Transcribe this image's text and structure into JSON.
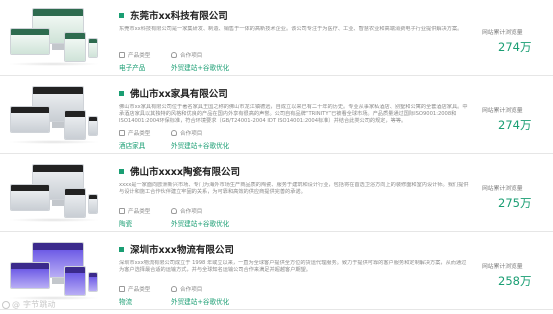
{
  "cases": [
    {
      "title": "东莞市xx科技有限公司",
      "description": "东莞市xx科技有限公司是一家集研发、制造、销售于一体的高新技术企业。该公司专注于为医疗、工业、智慧农业和高端消费电子行业提供解决方案。",
      "product_label": "产品类型",
      "product_value": "电子产品",
      "cooperation_label": "合作项目",
      "cooperation_value": "外贸建站+谷歌优化",
      "stat_label": "网站累计浏览量",
      "stat_value": "274万",
      "theme": "green"
    },
    {
      "title": "佛山市xx家具有限公司",
      "description": "佛山市xx家具有限公司位于著名家具王国之称的佛山市龙江镇德远，自成立以来已有二十年的历史。专业从事家私酒店、别墅和公寓的全套酒店家具。中承酒店家具以其独特的风格和优良的产品在国内外享有很高的声誉。公司自有品牌“TRINITY”已被看全球市场。产品质量通过国际ISO9001:2008和ISO14001:2004环保标准，符合环境要求（GB/T24001-2004 IDT ISO14001:2004标准）并结合此类公司的规定，等等。",
      "product_label": "产品类型",
      "product_value": "酒店家具",
      "cooperation_label": "合作项目",
      "cooperation_value": "外贸建站+谷歌优化",
      "stat_label": "网站累计浏览量",
      "stat_value": "274万",
      "theme": "dark"
    },
    {
      "title": "佛山市xxxx陶瓷有限公司",
      "description": "xxxx是一家面向欧洲新兴市场、专门为海外市场生产商品质的陶瓷、服务于建筑和设计行业，包括将在首选卫浴方向上的装修面和室内设计师。我们提供与设计和施工合作伙伴建立牢固的关系，为可靠和高效的供应商提供完善的承诺。",
      "product_label": "产品类型",
      "product_value": "陶瓷",
      "cooperation_label": "合作项目",
      "cooperation_value": "外贸建站+谷歌优化",
      "stat_label": "网站累计浏览量",
      "stat_value": "275万",
      "theme": "dark"
    },
    {
      "title": "深圳市xxx物流有限公司",
      "description": "深圳市xxx物流有限公司成立于 1998 年或立以来，一直为全球客户提供全方位的货运代理服务。致力于提供可靠的客户服务和定制解决方案，从而通过为客户选择最合适的运输方式，并与全球知名运输公司合作来满足并超越客户期望。",
      "product_label": "产品类型",
      "product_value": "物流",
      "cooperation_label": "合作项目",
      "cooperation_value": "外贸建站+谷歌优化",
      "stat_label": "网站累计浏览量",
      "stat_value": "258万",
      "theme": "purple"
    }
  ],
  "watermark": "@ 字节跳动",
  "colors": {
    "accent": "#1a9e73",
    "divider": "#e6e6e6"
  }
}
